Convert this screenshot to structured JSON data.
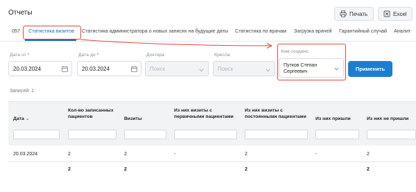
{
  "page_title": "Отчеты",
  "toolbar": {
    "print_label": "Печать",
    "excel_label": "Excel"
  },
  "tabs": [
    {
      "label": "057"
    },
    {
      "label": "Статистика визитов",
      "active": true
    },
    {
      "label": "Статистика администратора о новых записях на будущие даты"
    },
    {
      "label": "Статистика по врачам"
    },
    {
      "label": "Загрузка врачей"
    },
    {
      "label": "Гарантийный случай"
    },
    {
      "label": "Аналит"
    }
  ],
  "filters": {
    "date_from": {
      "label": "Дата от",
      "required_mark": "*",
      "value": "20.03.2024"
    },
    "date_to": {
      "label": "Дата до",
      "required_mark": "*",
      "value": "20.03.2024"
    },
    "doctor": {
      "label": "Доктора",
      "placeholder": "Поиск"
    },
    "chair": {
      "label": "Кресла",
      "placeholder": "Поиск"
    },
    "created_by": {
      "label": "Кем создано",
      "value_line1": "Путков Степан",
      "value_line2": "Сергеевич"
    },
    "apply_label": "Применить"
  },
  "records_label": "Записей: 1",
  "table": {
    "columns": [
      {
        "l1": "Дата",
        "l2": ""
      },
      {
        "l1": "Кол-во записанных",
        "l2": "пациентов"
      },
      {
        "l1": "Визиты",
        "l2": ""
      },
      {
        "l1": "Из них визиты с",
        "l2": "первичными пациентами"
      },
      {
        "l1": "Из них визиты с",
        "l2": "постоянными пациентами"
      },
      {
        "l1": "Из них пришли",
        "l2": ""
      },
      {
        "l1": "Из них не пришли",
        "l2": ""
      }
    ],
    "rows": [
      [
        "20.03.2024",
        "2",
        "2",
        "-",
        "2",
        "-",
        "2"
      ]
    ],
    "totals": [
      "",
      "2",
      "2",
      "",
      "2",
      "",
      "2"
    ]
  },
  "colors": {
    "accent": "#1f6fb2",
    "button": "#1d7ed1",
    "highlight": "#e0473d"
  },
  "icons": {
    "print": "printer-icon",
    "excel": "excel-icon",
    "calendar": "calendar-icon",
    "dropdown": "chevron-down-icon"
  }
}
